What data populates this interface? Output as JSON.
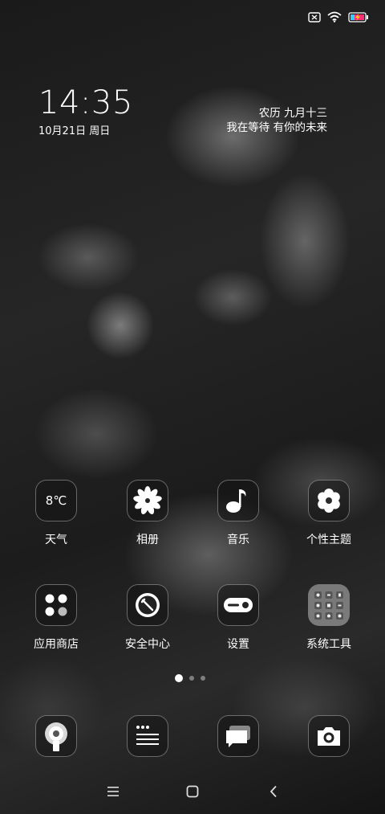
{
  "clock": {
    "time": "14:35",
    "date": "10月21日 周日"
  },
  "lunar": {
    "date": "农历 九月十三",
    "motto": "我在等待 有你的未来"
  },
  "apps_row1": [
    {
      "label": "天气",
      "icon": "weather-icon",
      "temp": "8℃"
    },
    {
      "label": "相册",
      "icon": "gallery-flower-icon"
    },
    {
      "label": "音乐",
      "icon": "music-note-icon"
    },
    {
      "label": "个性主题",
      "icon": "theme-flower-icon"
    }
  ],
  "apps_row2": [
    {
      "label": "应用商店",
      "icon": "app-store-dots-icon"
    },
    {
      "label": "安全中心",
      "icon": "security-icon"
    },
    {
      "label": "设置",
      "icon": "settings-toggle-icon"
    },
    {
      "label": "系统工具",
      "icon": "tools-folder-icon"
    }
  ],
  "dock": [
    {
      "icon": "phone-icon"
    },
    {
      "icon": "contacts-icon"
    },
    {
      "icon": "messages-icon"
    },
    {
      "icon": "camera-icon"
    }
  ],
  "pages": {
    "count": 3,
    "active": 0
  },
  "nav": {
    "menu": "menu-icon",
    "home": "home-icon",
    "back": "back-icon"
  },
  "colors": {
    "battery_charging": "#ff2d7a",
    "battery_bolt": "#ffe000"
  }
}
